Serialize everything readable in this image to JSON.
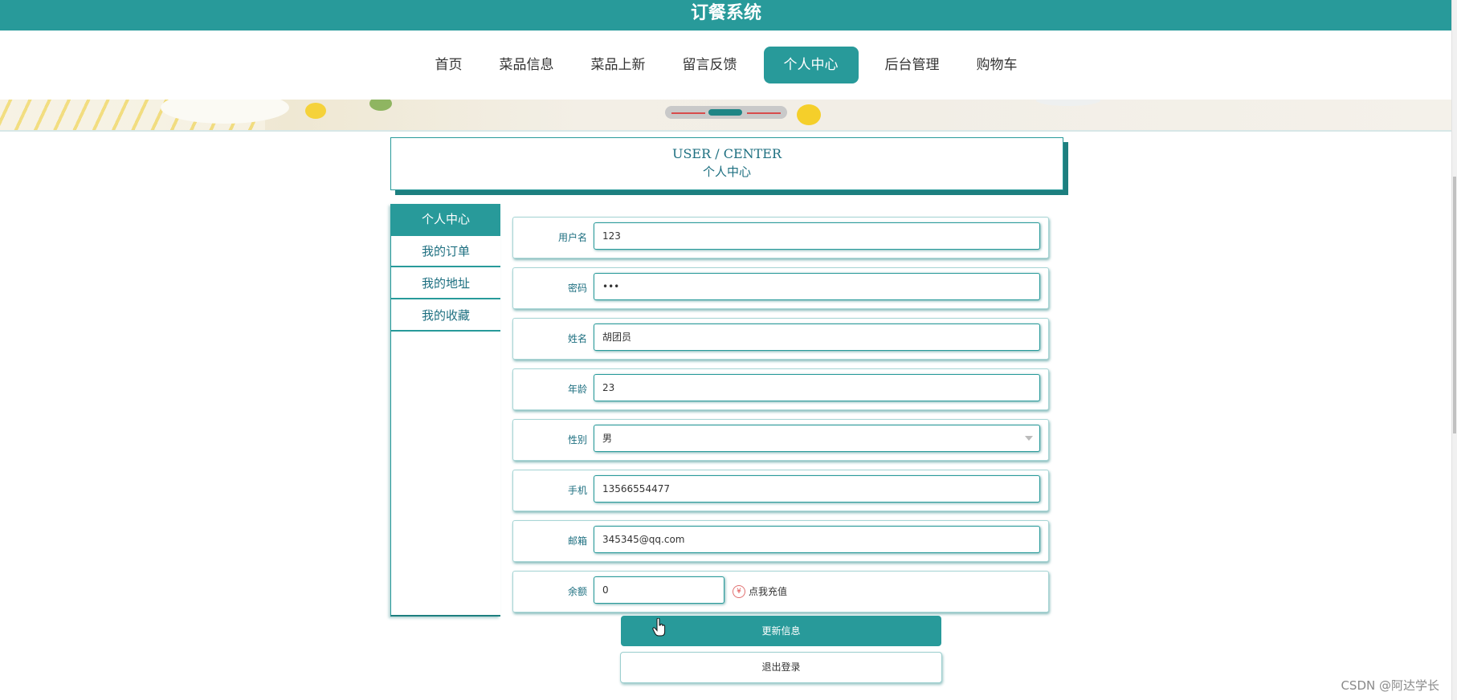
{
  "header": {
    "title": "订餐系统"
  },
  "nav": {
    "items": [
      {
        "label": "首页"
      },
      {
        "label": "菜品信息"
      },
      {
        "label": "菜品上新"
      },
      {
        "label": "留言反馈"
      },
      {
        "label": "个人中心",
        "active": true
      },
      {
        "label": "后台管理"
      },
      {
        "label": "购物车"
      }
    ]
  },
  "section_title": {
    "en": "USER / CENTER",
    "cn": "个人中心"
  },
  "sidebar": {
    "items": [
      {
        "label": "个人中心",
        "active": true
      },
      {
        "label": "我的订单"
      },
      {
        "label": "我的地址"
      },
      {
        "label": "我的收藏"
      }
    ]
  },
  "form": {
    "username": {
      "label": "用户名",
      "value": "123"
    },
    "password": {
      "label": "密码",
      "value": "•••"
    },
    "name": {
      "label": "姓名",
      "value": "胡团员"
    },
    "age": {
      "label": "年龄",
      "value": "23"
    },
    "gender": {
      "label": "性别",
      "value": "男"
    },
    "phone": {
      "label": "手机",
      "value": "13566554477"
    },
    "email": {
      "label": "邮箱",
      "value": "345345@qq.com"
    },
    "balance": {
      "label": "余额",
      "value": "0",
      "recharge_label": "点我充值",
      "recharge_icon": "¥"
    }
  },
  "buttons": {
    "update": "更新信息",
    "logout": "退出登录"
  },
  "watermark": "CSDN @阿达学长",
  "colors": {
    "primary": "#289a9a",
    "primary_dark": "#1d7f7f",
    "text_teal": "#1d6f80"
  }
}
